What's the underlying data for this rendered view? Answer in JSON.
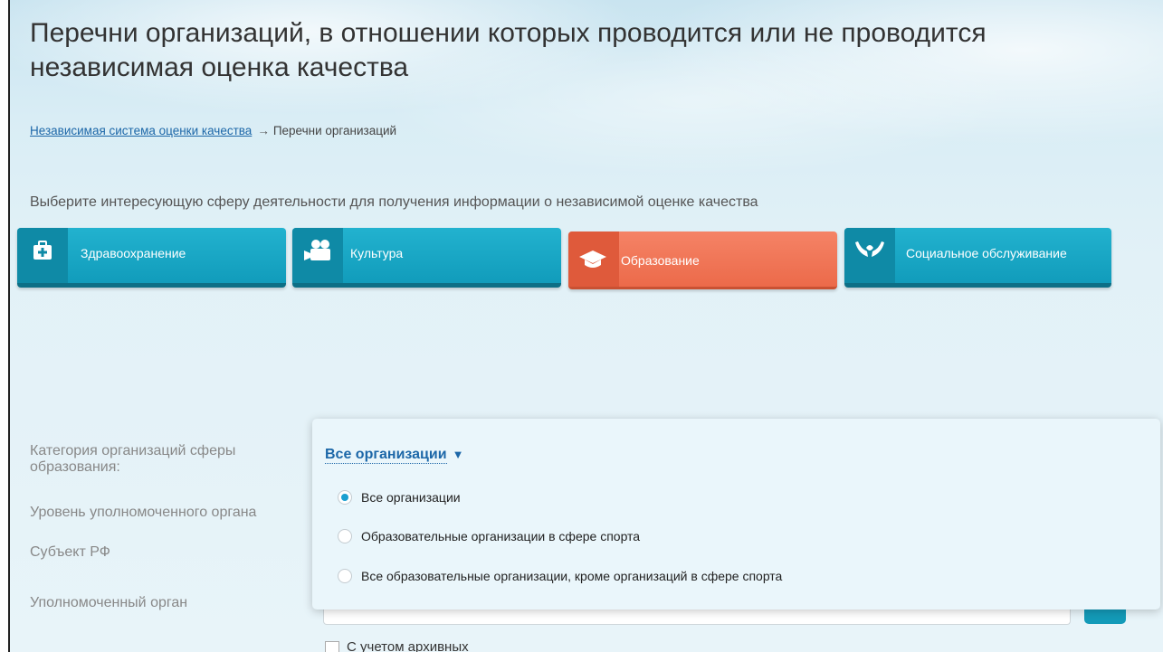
{
  "header": {
    "title": "Перечни организаций, в отношении которых проводится или не проводится независимая оценка качества"
  },
  "breadcrumb": {
    "parent": "Независимая система оценки качества",
    "arrow": "→",
    "current": "Перечни организаций"
  },
  "intro_text": "Выберите интересующую сферу деятельности для получения информации о независимой оценке качества",
  "spheres": [
    {
      "label": "Здравоохранение",
      "icon": "medical-kit-icon",
      "active": false
    },
    {
      "label": "Культура",
      "icon": "film-camera-icon",
      "active": false
    },
    {
      "label": "Образование",
      "icon": "graduation-cap-icon",
      "active": true
    },
    {
      "label": "Социальное обслуживание",
      "icon": "caring-hands-icon",
      "active": false
    }
  ],
  "form": {
    "category_label": "Категория организаций сферы образования:",
    "level_label": "Уровень уполномоченного органа",
    "subject_label": "Субъект РФ",
    "authority_label": "Уполномоченный орган",
    "archive_label": "С учетом архивных"
  },
  "category_dropdown": {
    "selected": "Все организации",
    "caret": "▼",
    "options": [
      {
        "label": "Все организации",
        "checked": true
      },
      {
        "label": "Образовательные организации в сфере спорта",
        "checked": false
      },
      {
        "label": "Все образовательные организации, кроме организаций в сфере спорта",
        "checked": false
      }
    ]
  },
  "colors": {
    "accent_teal": "#119cbb",
    "active_orange": "#ec6a4a",
    "link_blue": "#1c67a8"
  }
}
